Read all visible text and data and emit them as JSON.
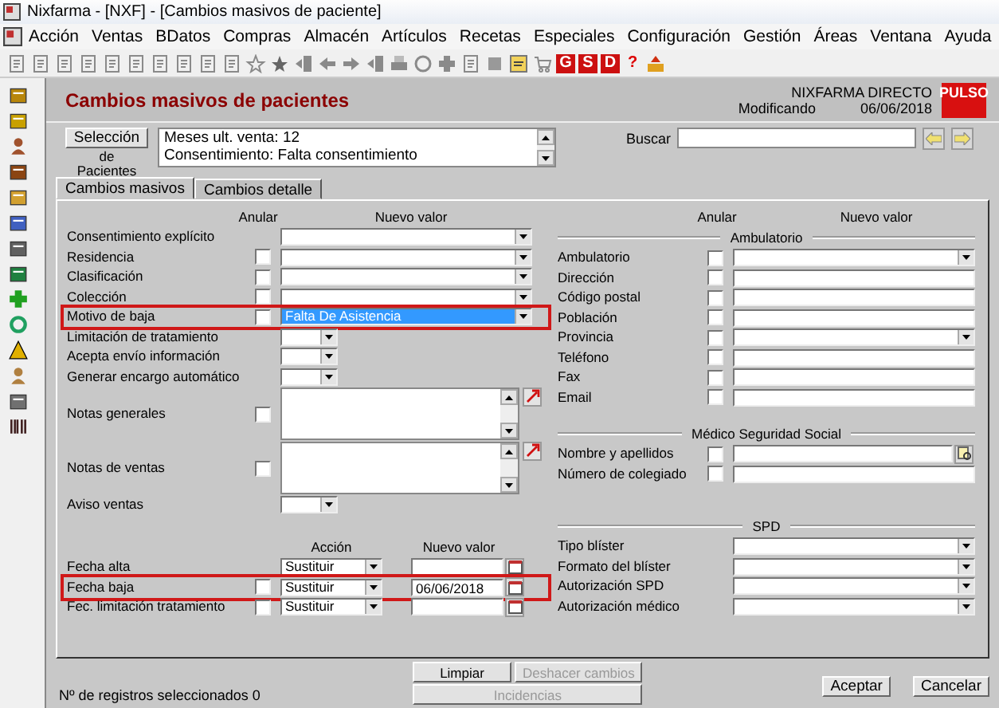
{
  "window": {
    "title": "Nixfarma - [NXF] - [Cambios masivos de paciente]"
  },
  "menu": [
    "Acción",
    "Ventas",
    "BDatos",
    "Compras",
    "Almacén",
    "Artículos",
    "Recetas",
    "Especiales",
    "Configuración",
    "Gestión",
    "Áreas",
    "Ventana",
    "Ayuda"
  ],
  "toolbar_buttons": [
    {
      "label": "G",
      "kind": "badge"
    },
    {
      "label": "S",
      "kind": "badge"
    },
    {
      "label": "D",
      "kind": "badge"
    },
    {
      "label": "?",
      "kind": "plain"
    }
  ],
  "header": {
    "title": "Cambios masivos de pacientes",
    "company": "NIXFARMA DIRECTO",
    "status": "Modificando",
    "date": "06/06/2018",
    "logo": "PULSO"
  },
  "selection": {
    "button": "Selección",
    "caption": "de Pacientes",
    "summary": [
      "Meses ult. venta: 12",
      "Consentimiento: Falta consentimiento"
    ],
    "search_label": "Buscar"
  },
  "tabs": [
    {
      "label": "Cambios masivos",
      "selected": true
    },
    {
      "label": "Cambios detalle",
      "selected": false
    }
  ],
  "left": {
    "headers": [
      "Anular",
      "Nuevo valor"
    ],
    "rows": [
      {
        "label": "Consentimiento explícito",
        "kind": "combo"
      },
      {
        "label": "Residencia",
        "kind": "combo",
        "checked": false
      },
      {
        "label": "Clasificación",
        "kind": "combo",
        "checked": false
      },
      {
        "label": "Colección",
        "kind": "combo",
        "checked": false
      },
      {
        "label": "Motivo de baja",
        "kind": "combo",
        "checked": false,
        "value": "Falta De Asistencia",
        "value_selected": true,
        "highlighted": true
      },
      {
        "label": "Limitación de tratamiento",
        "kind": "small_combo"
      },
      {
        "label": "Acepta envío información",
        "kind": "small_combo"
      },
      {
        "label": "Generar encargo automático",
        "kind": "small_combo"
      },
      {
        "label": "Notas generales",
        "kind": "notes",
        "checked": false
      },
      {
        "label": "Notas de ventas",
        "kind": "notes",
        "checked": false
      },
      {
        "label": "Aviso ventas",
        "kind": "small_combo"
      }
    ]
  },
  "dates": {
    "headers": [
      "Acción",
      "Nuevo valor"
    ],
    "rows": [
      {
        "label": "Fecha alta",
        "action": "Sustituir",
        "highlighted": false
      },
      {
        "label": "Fecha baja",
        "checked": false,
        "action": "Sustituir",
        "value": "06/06/2018",
        "highlighted": true
      },
      {
        "label": "Fec. limitación tratamiento",
        "checked": false,
        "action": "Sustituir",
        "highlighted": false
      }
    ]
  },
  "right": {
    "headers": [
      "Anular",
      "Nuevo valor"
    ],
    "sections": [
      {
        "title": "Ambulatorio",
        "rows": [
          {
            "label": "Ambulatorio",
            "kind": "combo",
            "checked": false
          },
          {
            "label": "Dirección",
            "kind": "text",
            "checked": false
          },
          {
            "label": "Código postal",
            "kind": "text",
            "checked": false
          },
          {
            "label": "Población",
            "kind": "text",
            "checked": false
          },
          {
            "label": "Provincia",
            "kind": "combo",
            "checked": false
          },
          {
            "label": "Teléfono",
            "kind": "text",
            "checked": false
          },
          {
            "label": "Fax",
            "kind": "text",
            "checked": false
          },
          {
            "label": "Email",
            "kind": "text",
            "checked": false
          }
        ]
      },
      {
        "title": "Médico Seguridad Social",
        "rows": [
          {
            "label": "Nombre y apellidos",
            "kind": "lookup",
            "checked": false
          },
          {
            "label": "Número de colegiado",
            "kind": "text",
            "checked": false
          }
        ]
      },
      {
        "title": "SPD",
        "rows": [
          {
            "label": "Tipo blíster",
            "kind": "combo"
          },
          {
            "label": "Formato del blíster",
            "kind": "combo"
          },
          {
            "label": "Autorización SPD",
            "kind": "combo"
          },
          {
            "label": "Autorización médico",
            "kind": "combo"
          }
        ]
      }
    ]
  },
  "footer": {
    "buttons": [
      {
        "label": "Limpiar",
        "disabled": false
      },
      {
        "label": "Deshacer cambios",
        "disabled": true
      },
      {
        "label": "Incidencias",
        "disabled": true
      }
    ],
    "actions": [
      {
        "label": "Aceptar"
      },
      {
        "label": "Cancelar"
      }
    ],
    "status": "Nº de registros seleccionados 0"
  }
}
